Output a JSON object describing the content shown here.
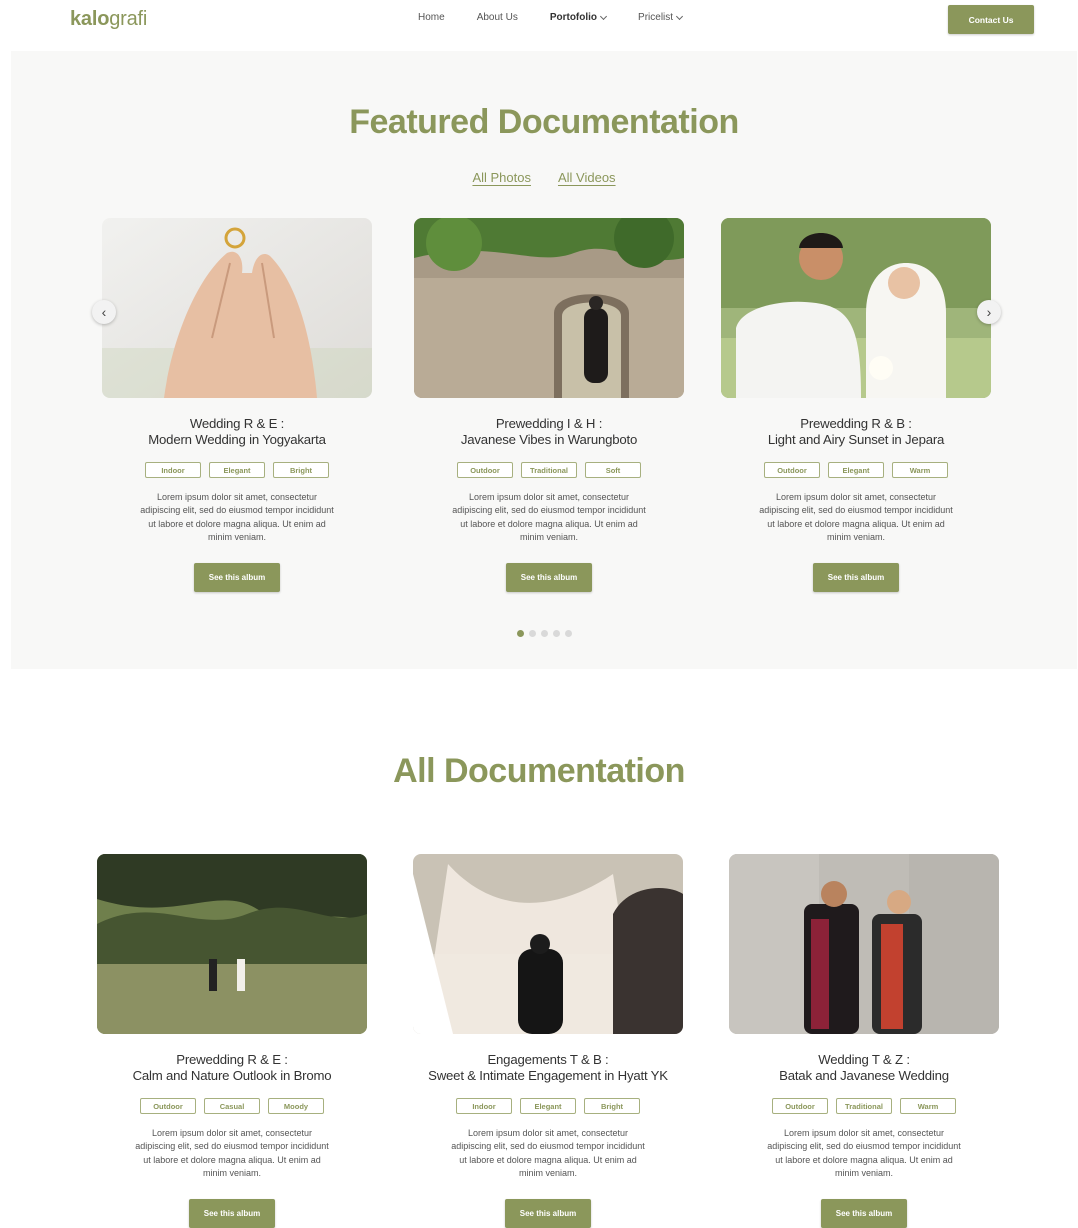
{
  "header": {
    "logo_bold": "kalo",
    "logo_light": "grafi",
    "nav": [
      {
        "label": "Home"
      },
      {
        "label": "About Us"
      },
      {
        "label": "Portofolio"
      },
      {
        "label": "Pricelist"
      }
    ],
    "contact_label": "Contact Us"
  },
  "featured": {
    "title": "Featured Documentation",
    "tabs": [
      "All Photos",
      "All Videos"
    ],
    "cards": [
      {
        "title_1": "Wedding R & E :",
        "title_2": "Modern Wedding in Yogyakarta",
        "tags": [
          "Indoor",
          "Elegant",
          "Bright"
        ],
        "desc": "Lorem ipsum dolor sit amet, consectetur adipiscing elit, sed do eiusmod tempor incididunt ut labore et dolore magna aliqua. Ut enim ad minim veniam.",
        "button": "See this album"
      },
      {
        "title_1": "Prewedding I & H :",
        "title_2": "Javanese Vibes in Warungboto",
        "tags": [
          "Outdoor",
          "Traditional",
          "Soft"
        ],
        "desc": "Lorem ipsum dolor sit amet, consectetur adipiscing elit, sed do eiusmod tempor incididunt ut labore et dolore magna aliqua. Ut enim ad minim veniam.",
        "button": "See this album"
      },
      {
        "title_1": "Prewedding R & B :",
        "title_2": "Light and Airy Sunset in Jepara",
        "tags": [
          "Outdoor",
          "Elegant",
          "Warm"
        ],
        "desc": "Lorem ipsum dolor sit amet, consectetur adipiscing elit, sed do eiusmod tempor incididunt ut labore et dolore magna aliqua. Ut enim ad minim veniam.",
        "button": "See this album"
      }
    ],
    "arrow_left": "‹",
    "arrow_right": "›"
  },
  "all": {
    "title": "All Documentation",
    "cards": [
      {
        "title_1": "Prewedding R & E :",
        "title_2": "Calm and Nature Outlook in Bromo",
        "tags": [
          "Outdoor",
          "Casual",
          "Moody"
        ],
        "desc": "Lorem ipsum dolor sit amet, consectetur adipiscing elit, sed do eiusmod tempor incididunt ut labore et dolore magna aliqua. Ut enim ad minim veniam.",
        "button": "See this album"
      },
      {
        "title_1": "Engagements T & B :",
        "title_2": "Sweet & Intimate Engagement in Hyatt YK",
        "tags": [
          "Indoor",
          "Elegant",
          "Bright"
        ],
        "desc": "Lorem ipsum dolor sit amet, consectetur adipiscing elit, sed do eiusmod tempor incididunt ut labore et dolore magna aliqua. Ut enim ad minim veniam.",
        "button": "See this album"
      },
      {
        "title_1": "Wedding T & Z :",
        "title_2": "Batak and Javanese Wedding",
        "tags": [
          "Outdoor",
          "Traditional",
          "Warm"
        ],
        "desc": "Lorem ipsum dolor sit amet, consectetur adipiscing elit, sed do eiusmod tempor incididunt ut labore et dolore magna aliqua. Ut enim ad minim veniam.",
        "button": "See this album"
      }
    ]
  },
  "colors": {
    "accent": "#8b975b",
    "section_bg": "#f8f8f7"
  }
}
